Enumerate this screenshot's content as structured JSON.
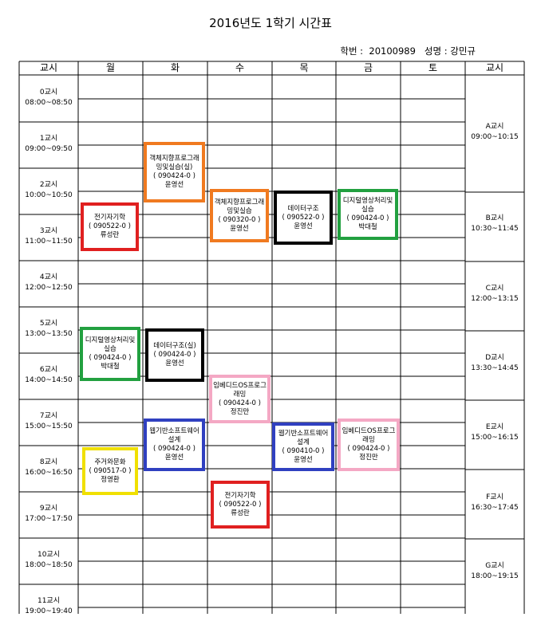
{
  "title": "2016년도 1학기 시간표",
  "student": {
    "id_label": "학번 :",
    "id": "20100989",
    "name_label": "성명 :",
    "name": "강민규"
  },
  "headers": [
    "교시",
    "월",
    "화",
    "수",
    "목",
    "금",
    "토",
    "교시"
  ],
  "left_periods": [
    {
      "name": "0교시",
      "time": "08:00~08:50"
    },
    {
      "name": "1교시",
      "time": "09:00~09:50"
    },
    {
      "name": "2교시",
      "time": "10:00~10:50"
    },
    {
      "name": "3교시",
      "time": "11:00~11:50"
    },
    {
      "name": "4교시",
      "time": "12:00~12:50"
    },
    {
      "name": "5교시",
      "time": "13:00~13:50"
    },
    {
      "name": "6교시",
      "time": "14:00~14:50"
    },
    {
      "name": "7교시",
      "time": "15:00~15:50"
    },
    {
      "name": "8교시",
      "time": "16:00~16:50"
    },
    {
      "name": "9교시",
      "time": "17:00~17:50"
    },
    {
      "name": "10교시",
      "time": "18:00~18:50"
    },
    {
      "name": "11교시",
      "time": "19:00~19:40"
    }
  ],
  "right_periods": [
    {
      "name": "A교시",
      "time": "09:00~10:15"
    },
    {
      "name": "B교시",
      "time": "10:30~11:45"
    },
    {
      "name": "C교시",
      "time": "12:00~13:15"
    },
    {
      "name": "D교시",
      "time": "13:30~14:45"
    },
    {
      "name": "E교시",
      "time": "15:00~16:15"
    },
    {
      "name": "F교시",
      "time": "16:30~17:45"
    },
    {
      "name": "G교시",
      "time": "18:00~19:15"
    }
  ],
  "classes": [
    {
      "name": "객체지향프로그래밍및실습(실)",
      "code": "( 090424-0 )",
      "prof": "윤영선",
      "color": "#f07a20"
    },
    {
      "name": "전기자기학",
      "code": "( 090522-0 )",
      "prof": "류성란",
      "color": "#e02020"
    },
    {
      "name": "객체지향프로그래밍및실습",
      "code": "( 090320-0 )",
      "prof": "윤영선",
      "color": "#f07a20"
    },
    {
      "name": "데이터구조",
      "code": "( 090522-0 )",
      "prof": "윤영선",
      "color": "#000000"
    },
    {
      "name": "디지털영상처리및실습",
      "code": "( 090424-0 )",
      "prof": "박대철",
      "color": "#22a040"
    },
    {
      "name": "디지털영상처리및실습",
      "code": "( 090424-0 )",
      "prof": "박대철",
      "color": "#22a040"
    },
    {
      "name": "데이터구조(실)",
      "code": "( 090424-0 )",
      "prof": "윤영선",
      "color": "#000000"
    },
    {
      "name": "임베디드OS프로그래밍",
      "code": "( 090424-0 )",
      "prof": "정진만",
      "color": "#f4a8c4"
    },
    {
      "name": "웹기반소프트웨어설계",
      "code": "( 090424-0 )",
      "prof": "윤영선",
      "color": "#3040c0"
    },
    {
      "name": "웹기반소프트웨어설계",
      "code": "( 090410-0 )",
      "prof": "윤영선",
      "color": "#3040c0"
    },
    {
      "name": "임베디드OS프로그래밍",
      "code": "( 090424-0 )",
      "prof": "정진만",
      "color": "#f4a8c4"
    },
    {
      "name": "주거와문화",
      "code": "( 090517-0 )",
      "prof": "정영환",
      "color": "#f0e000"
    },
    {
      "name": "전기자기학",
      "code": "( 090522-0 )",
      "prof": "류성란",
      "color": "#e02020"
    }
  ]
}
